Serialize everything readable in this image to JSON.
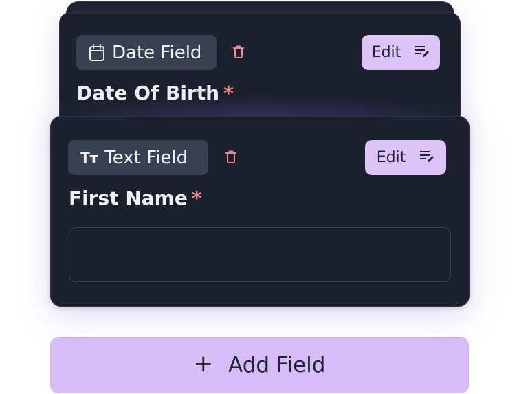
{
  "cards": [
    {
      "type_label": "Date Field",
      "type_icon": "calendar-icon",
      "edit_label": "Edit",
      "field_label": "Date Of Birth",
      "required_mark": "*"
    },
    {
      "type_label": "Text Field",
      "type_icon": "text-type-icon",
      "type_icon_text": "Tт",
      "edit_label": "Edit",
      "field_label": "First Name",
      "required_mark": "*",
      "input_value": "",
      "input_placeholder": ""
    }
  ],
  "add_field": {
    "plus": "+",
    "label": "Add Field"
  },
  "colors": {
    "card_bg": "#1c202d",
    "chip_bg": "#394050",
    "accent": "#dcc4f8",
    "required": "#f08a8a",
    "trash": "#f08a8a"
  }
}
